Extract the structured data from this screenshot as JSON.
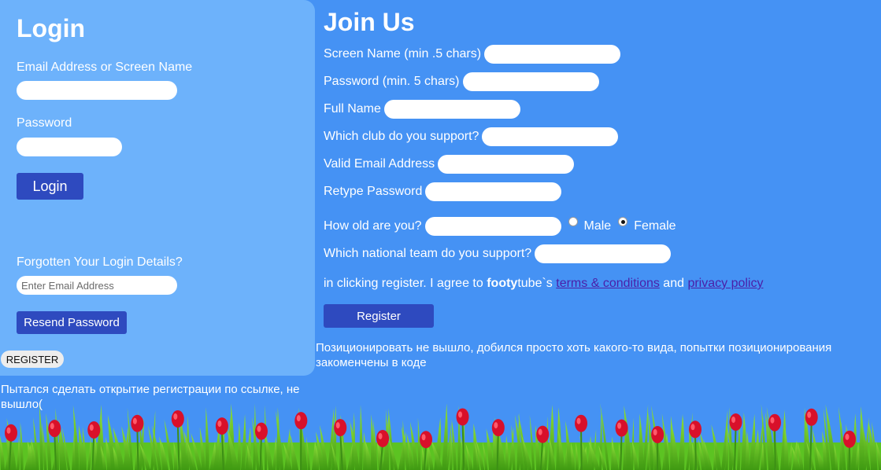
{
  "login": {
    "title": "Login",
    "email_label": "Email Address or Screen Name",
    "password_label": "Password",
    "login_button": "Login",
    "forgot_label": "Forgotten Your Login Details?",
    "forgot_placeholder": "Enter Email Address",
    "resend_button": "Resend Password",
    "register_button": "REGISTER",
    "note": "Пытался сделать открытие регистрации по ссылке, не вышло("
  },
  "join": {
    "title": "Join Us",
    "fields": {
      "screen_name": "Screen Name (min .5 chars)",
      "password": "Password (min. 5 chars)",
      "full_name": "Full Name",
      "club": "Which club do you support?",
      "email": "Valid Email Address",
      "retype": "Retype Password",
      "age": "How old are you?",
      "national": "Which national team do you support?"
    },
    "gender": {
      "male": "Male",
      "female": "Female",
      "selected": "Female"
    },
    "agree": {
      "prefix": "in clicking register. I agree to ",
      "brand_bold": "footy",
      "brand_rest": "tube`s ",
      "terms": "terms & conditions",
      "and": " and ",
      "privacy": "privacy policy"
    },
    "register_button": "Register",
    "note": "Позиционировать не вышло, добился просто хоть какого-то вида, попытки позиционирования закоменчены в коде"
  },
  "colors": {
    "background": "#4592f4",
    "login_panel": "#6db2fb",
    "button": "#2e4abf",
    "link": "#4b1fa8",
    "tulip": "#d8102a",
    "grass": "#5cc322"
  }
}
